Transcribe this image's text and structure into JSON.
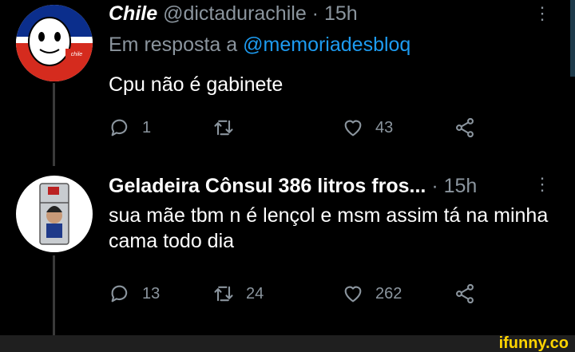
{
  "tweets": [
    {
      "name": "Chile",
      "handle": "@dictadurachile",
      "separator": "·",
      "time": "15h",
      "reply_label": "Em resposta a",
      "reply_mention": "@memoriadesbloq",
      "text": "Cpu não é gabinete",
      "replies": "1",
      "retweets": "",
      "likes": "43",
      "avatar_label": "chile"
    },
    {
      "name": "Geladeira Cônsul 386 litros fros...",
      "separator": "·",
      "time": "15h",
      "text": "sua mãe tbm n é lençol e msm assim tá na minha cama todo dia",
      "replies": "13",
      "retweets": "24",
      "likes": "262"
    }
  ],
  "menu_icon": "⋮",
  "watermark": "ifunny.co",
  "colors": {
    "background": "#000000",
    "muted": "#8b959e",
    "link": "#1d9bf0",
    "watermark": "#ffd400"
  }
}
